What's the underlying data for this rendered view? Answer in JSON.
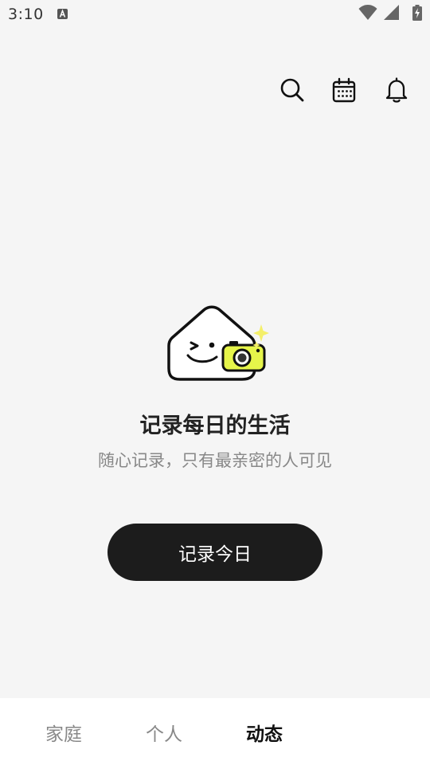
{
  "status_bar": {
    "time": "3:10",
    "notification_icon": "a-icon",
    "icons": [
      "wifi-icon",
      "signal-icon",
      "battery-icon"
    ]
  },
  "top_bar": {
    "icons": [
      "search-icon",
      "calendar-icon",
      "bell-icon"
    ]
  },
  "empty_state": {
    "illustration": "house-camera-illustration",
    "title": "记录每日的生活",
    "subtitle": "随心记录，只有最亲密的人可见",
    "button_label": "记录今日",
    "accent_color": "#e6f54a"
  },
  "bottom_nav": {
    "tabs": [
      {
        "label": "家庭"
      },
      {
        "label": "个人"
      },
      {
        "label": "动态"
      }
    ],
    "active_tab": "动态"
  }
}
